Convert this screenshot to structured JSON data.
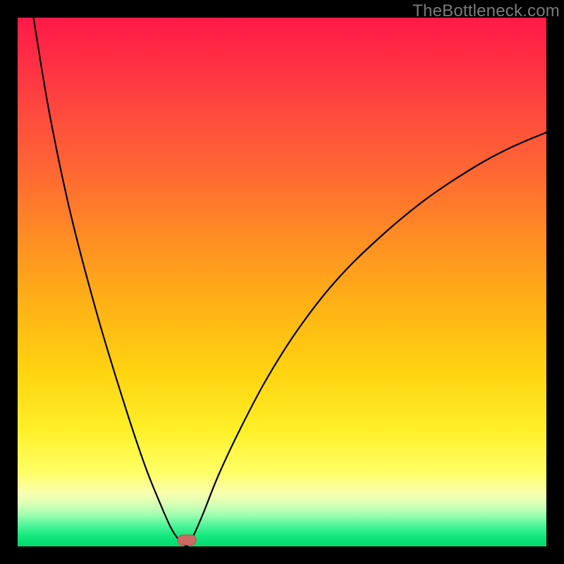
{
  "watermark": {
    "text": "TheBottleneck.com"
  },
  "chart_data": {
    "type": "line",
    "title": "",
    "xlabel": "",
    "ylabel": "",
    "xlim": [
      0,
      100
    ],
    "ylim": [
      0,
      100
    ],
    "grid": false,
    "legend": false,
    "series": [
      {
        "name": "left-curve",
        "x": [
          3,
          6,
          10,
          15,
          20,
          24,
          27,
          29,
          30.5,
          31.5,
          32
        ],
        "values": [
          100,
          82,
          63,
          44,
          27.5,
          15.5,
          8,
          3.5,
          1.2,
          0.3,
          0
        ]
      },
      {
        "name": "right-curve",
        "x": [
          32,
          33,
          35,
          38,
          42,
          47,
          53,
          60,
          68,
          77,
          86,
          93,
          100
        ],
        "values": [
          0,
          1.5,
          6,
          13.5,
          22,
          31.5,
          41,
          50,
          58,
          65.5,
          71.5,
          75.3,
          78.3
        ]
      }
    ],
    "marker": {
      "x": 32,
      "y": 1.2
    },
    "background": {
      "top_color": "#ff1a46",
      "mid_color": "#ffd310",
      "bottom_color": "#00d96e"
    }
  }
}
